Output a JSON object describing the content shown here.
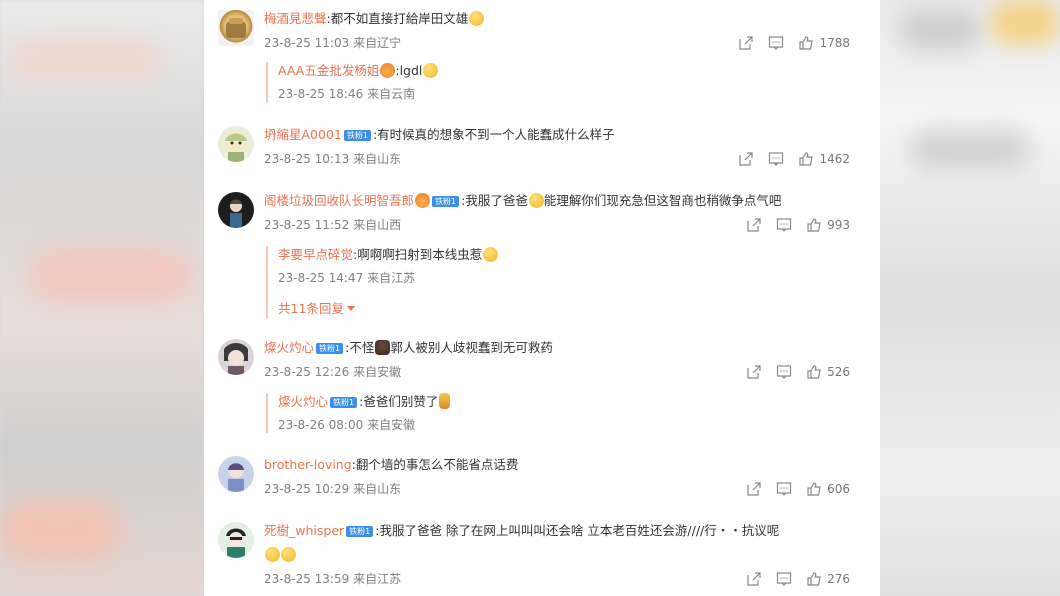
{
  "comments": [
    {
      "user": "梅酒見悲聲",
      "text": ":都不如直接打給岸田文雄",
      "time": "23-8-25 11:03",
      "location": "来自辽宁",
      "likes": "1788",
      "replies": [
        {
          "user": "AAA五金批发杨姐",
          "text": ":lgdl",
          "time": "23-8-25 18:46",
          "location": "来自云南"
        }
      ]
    },
    {
      "user": "坍縮星A0001",
      "badge": "铁粉1",
      "text": ":有时候真的想象不到一个人能蠢成什么样子",
      "time": "23-8-25 10:13",
      "location": "来自山东",
      "likes": "1462"
    },
    {
      "user": "阁楼垃圾回收队长明智吾郎",
      "badge": "铁粉1",
      "text": ":我服了爸爸",
      "text2": "能理解你们现充急但这智商也稍微争点气吧",
      "time": "23-8-25 11:52",
      "location": "来自山西",
      "likes": "993",
      "replies": [
        {
          "user": "李要早点碎觉",
          "text": ":啊啊啊扫射到本线虫惹",
          "time": "23-8-25 14:47",
          "location": "来自江苏"
        }
      ],
      "more_replies": "共11条回复"
    },
    {
      "user": "燦火灼心",
      "badge": "铁粉1",
      "text": ":不怪",
      "text2": "郭人被别人歧视蠢到无可救药",
      "time": "23-8-25 12:26",
      "location": "来自安徽",
      "likes": "526",
      "replies": [
        {
          "user": "燦火灼心",
          "badge": "铁粉1",
          "text": ":爸爸们别赞了",
          "time": "23-8-26 08:00",
          "location": "来自安徽"
        }
      ]
    },
    {
      "user": "brother-loving",
      "text": ":翻个墙的事怎么不能省点话费",
      "time": "23-8-25 10:29",
      "location": "来自山东",
      "likes": "606"
    },
    {
      "user": "死樹_whisper",
      "badge": "铁粉1",
      "text": ":我服了爸爸 除了在网上叫叫叫还会啥 立本老百姓还会游////行・・抗议呢",
      "time": "23-8-25 13:59",
      "location": "来自江苏",
      "likes": "276"
    }
  ],
  "icons": {
    "share": "share-icon",
    "comment": "comment-icon",
    "like": "like-icon"
  },
  "colors": {
    "username": "#eb7350",
    "badge": "#3b8fe8",
    "meta": "#808080"
  }
}
